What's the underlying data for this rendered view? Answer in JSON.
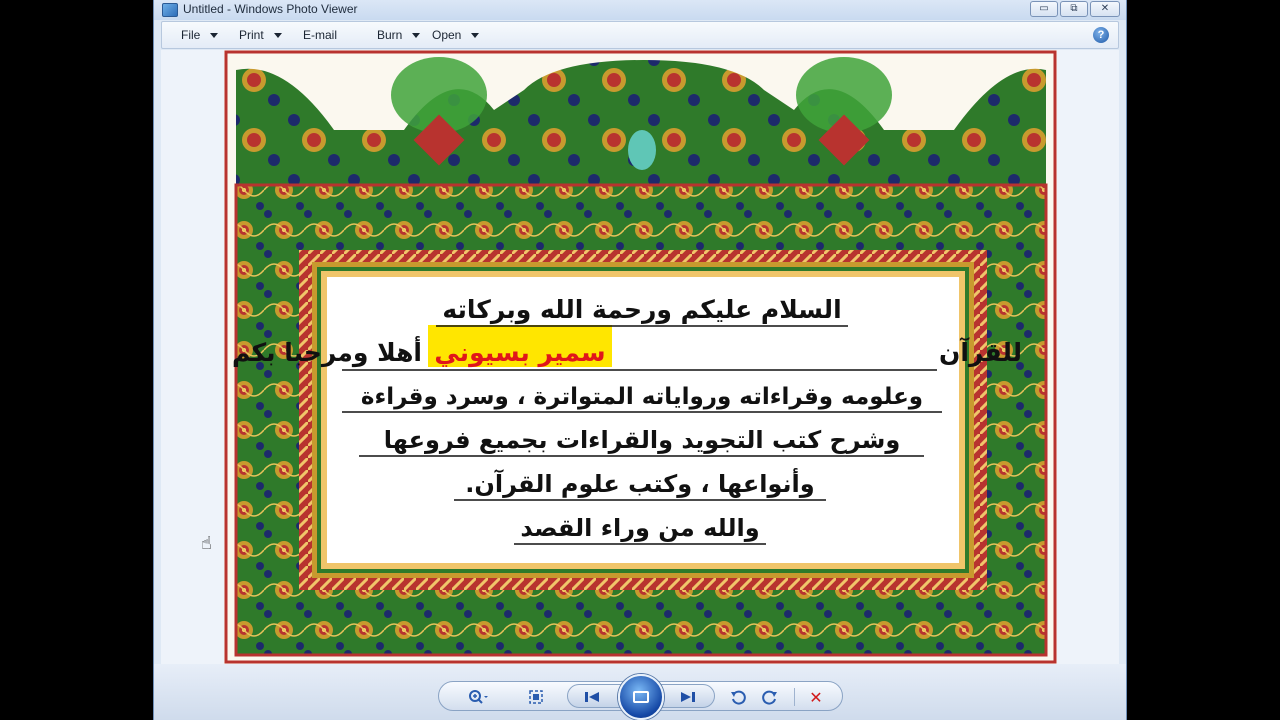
{
  "window": {
    "title": "Untitled - Windows Photo Viewer",
    "minimize_glyph": "▭",
    "maximize_glyph": "⧉",
    "close_glyph": "✕"
  },
  "menubar": {
    "items": [
      {
        "label": "File",
        "has_dropdown": true
      },
      {
        "label": "Print",
        "has_dropdown": true
      },
      {
        "label": "E-mail",
        "has_dropdown": false
      },
      {
        "label": "Burn",
        "has_dropdown": true
      },
      {
        "label": "Open",
        "has_dropdown": true
      }
    ],
    "help_glyph": "?"
  },
  "photo": {
    "lines": [
      "السلام عليكم ورحمة الله وبركاته",
      "أهلا ومرحبا بكم في قناة:",
      "سمير بسيوني",
      "للقرآن",
      "وعلومه وقراءاته ورواياته المتواترة ، وسرد وقراءة",
      "وشرح كتب التجويد والقراءات بجميع فروعها",
      "وأنواعها ، وكتب علوم القرآن.",
      "والله من وراء القصد"
    ],
    "highlight_color": "#ffe600",
    "highlight_text_color": "#e0161b",
    "frame_green": "#2f7a2a",
    "frame_red": "#b8332f",
    "frame_gold": "#c89a2e",
    "frame_navy": "#1d2a6b"
  },
  "toolbar": {
    "zoom_icon": "zoom-icon",
    "fit_icon": "actual-size-icon",
    "prev_icon": "previous-icon",
    "slideshow_icon": "slideshow-icon",
    "next_icon": "next-icon",
    "rotate_ccw_icon": "rotate-counterclockwise-icon",
    "rotate_cw_icon": "rotate-clockwise-icon",
    "delete_glyph": "✕"
  }
}
